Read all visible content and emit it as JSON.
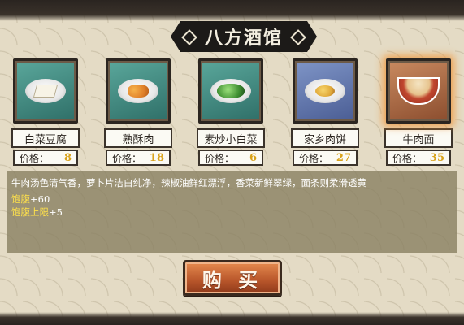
{
  "title": "八方酒馆",
  "price_label": "价格：",
  "items": [
    {
      "name": "白菜豆腐",
      "price": "8",
      "icon": "tofu-cabbage-dish"
    },
    {
      "name": "熟酥肉",
      "price": "18",
      "icon": "fried-pork-dish"
    },
    {
      "name": "素炒小白菜",
      "price": "6",
      "icon": "stir-fried-bokchoy-dish"
    },
    {
      "name": "家乡肉饼",
      "price": "27",
      "icon": "meat-pie-dish"
    },
    {
      "name": "牛肉面",
      "price": "35",
      "icon": "beef-noodle-bowl",
      "selected": true
    }
  ],
  "description": "牛肉汤色清气香，萝卜片洁白纯净，辣椒油鲜红漂浮，香菜新鲜翠绿，面条则柔滑透黄",
  "stats": [
    {
      "label": "饱腹",
      "value": "+60"
    },
    {
      "label": "饱腹上限",
      "value": "+5"
    }
  ],
  "buy_label": "购 买",
  "colors": {
    "price": "#d9a21a",
    "stat_label": "#ffe14a",
    "selected_glow": "#f0963c"
  }
}
